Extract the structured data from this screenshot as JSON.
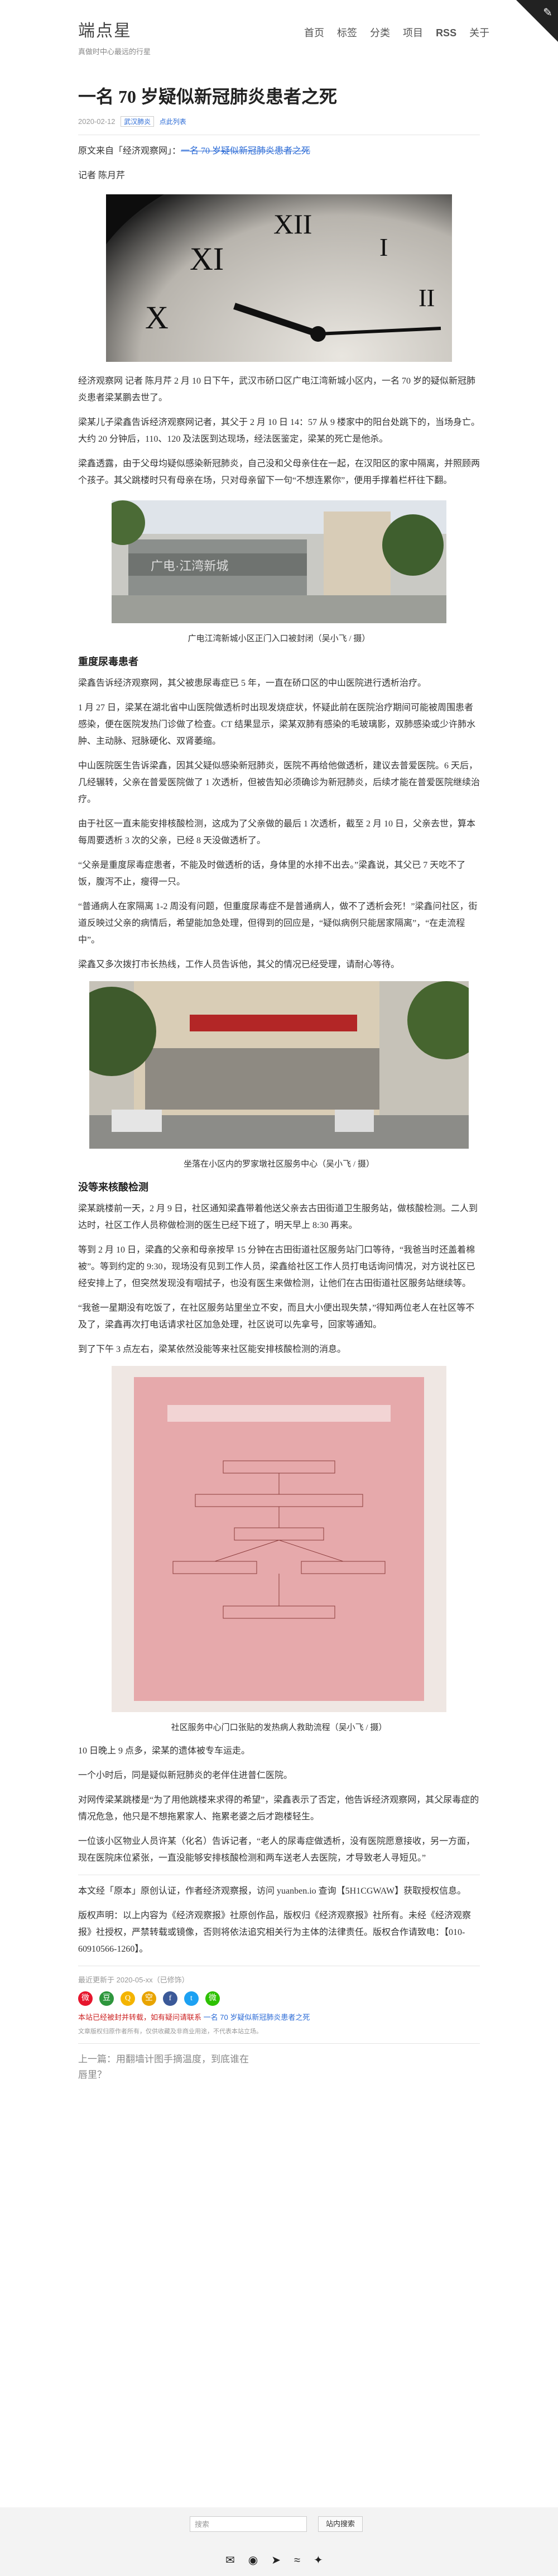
{
  "site": {
    "title": "端点星",
    "subtitle": "真做时中心最远的行星"
  },
  "nav": [
    "首页",
    "标签",
    "分类",
    "项目",
    "RSS",
    "关于"
  ],
  "article": {
    "title": "一名 70 岁疑似新冠肺炎患者之死",
    "date": "2020-02-12",
    "tag1": "武汉肺炎",
    "tag2": "点此列表",
    "source_prefix": "原文来自「经济观察网」：",
    "source_link": "一名 70 岁疑似新冠肺炎患者之死",
    "author": "记者 陈月芹",
    "paragraphs": [
      "经济观察网 记者 陈月芹 2 月 10 日下午，武汉市硚口区广电江湾新城小区内，一名 70 岁的疑似新冠肺炎患者梁某鹏去世了。",
      "梁某儿子梁鑫告诉经济观察网记者，其父于 2 月 10 日 14：57 从 9 楼家中的阳台处跳下的，当场身亡。大约 20 分钟后，110、120 及法医到达现场，经法医鉴定，梁某的死亡是他杀。",
      "梁鑫透露，由于父母均疑似感染新冠肺炎，自己没和父母亲住在一起，在汉阳区的家中隔离，并照顾两个孩子。其父跳楼时只有母亲在场，只对母亲留下一句“不想连累你”，便用手撑着栏杆往下翻。"
    ],
    "cap1": "广电江湾新城小区正门入口被封闭（吴小飞 / 摄）",
    "h_section1": "重度尿毒患者",
    "paragraphs2": [
      "梁鑫告诉经济观察网，其父被患尿毒症已 5 年，一直在硚口区的中山医院进行透析治疗。",
      "1 月 27 日，梁某在湖北省中山医院做透析时出现发烧症状，怀疑此前在医院治疗期间可能被周围患者感染，便在医院发热门诊做了检查。CT 结果显示，梁某双肺有感染的毛玻璃影，双肺感染或少许肺水肿、主动脉、冠脉硬化、双肾萎缩。",
      "中山医院医生告诉梁鑫，因其父疑似感染新冠肺炎，医院不再给他做透析，建议去普爱医院。6 天后，几经辗转，父亲在普爱医院做了 1 次透析，但被告知必须确诊为新冠肺炎，后续才能在普爱医院继续治疗。",
      "由于社区一直未能安排核酸检测，这成为了父亲做的最后 1 次透析，截至 2 月 10 日，父亲去世，算本每周要透析 3 次的父亲，已经 8 天没做透析了。",
      "“父亲是重度尿毒症患者，不能及时做透析的话，身体里的水排不出去。”梁鑫说，其父已 7 天吃不了饭，腹泻不止，瘦得一只。",
      "“普通病人在家隔离 1-2 周没有问题，但重度尿毒症不是普通病人，做不了透析会死！”梁鑫问社区，街道反映过父亲的病情后，希望能加急处理，但得到的回应是，“疑似病例只能居家隔离”，“在走流程中”。",
      "梁鑫又多次拨打市长热线，工作人员告诉他，其父的情况已经受理，请耐心等待。"
    ],
    "cap2": "坐落在小区内的罗家墩社区服务中心（吴小飞 / 摄）",
    "h_section2": "没等来核酸检测",
    "paragraphs3": [
      "梁某跳楼前一天，2 月 9 日，社区通知梁鑫带着他送父亲去古田街道卫生服务站，做核酸检测。二人到达时，社区工作人员称做检测的医生已经下班了，明天早上 8:30 再来。",
      "等到 2 月 10 日，梁鑫的父亲和母亲按早 15 分钟在古田街道社区服务站门口等待，“我爸当时还盖着棉被”。等到约定的 9:30，现场没有见到工作人员，梁鑫给社区工作人员打电话询问情况，对方说社区已经安排上了，但突然发现没有咽拭子，也没有医生来做检测，让他们在古田街道社区服务站继续等。",
      "“我爸一星期没有吃饭了，在社区服务站里坐立不安，而且大小便出现失禁，”得知两位老人在社区等不及了，梁鑫再次打电话请求社区加急处理，社区说可以先拿号，回家等通知。",
      "到了下午 3 点左右，梁某依然没能等来社区能安排核酸检测的消息。"
    ],
    "cap3": "社区服务中心门口张贴的发热病人救助流程（吴小飞 / 摄）",
    "paragraphs4": [
      "10 日晚上 9 点多，梁某的遗体被专车运走。",
      "一个小时后，同是疑似新冠肺炎的老伴住进普仁医院。",
      "对网传梁某跳楼是“为了用他跳楼来求得的希望”，梁鑫表示了否定，他告诉经济观察网，其父尿毒症的情况危急，他只是不想拖累家人、拖累老婆之后才跑楼轻生。",
      "一位该小区物业人员许某（化名）告诉记者，“老人的尿毒症做透析，没有医院愿意接收，另一方面，现在医院床位紧张，一直没能够安排核酸检测和两车送老人去医院，才导致老人寻短见。”"
    ],
    "notice_para": "本文经「原本」原创认证，作者经济观察报，访问 yuanben.io 查询【5H1CGWAW】获取授权信息。",
    "copyright_para": "版权声明：以上内容为《经济观察报》社原创作品，版权归《经济观察报》社所有。未经《经济观察报》社授权，严禁转载或镜像，否则将依法追究相关行为主体的法律责任。版权合作请致电：【010-60910566-1260】。",
    "updated": "最近更新于 2020-05-xx（已修饰）",
    "share_note": "本站已经被封并转载，如有疑问请联系",
    "small_note": "文章版权归原作者所有，仅供收藏及非商业用途，不代表本站立场。",
    "prev_label": "上一篇：用翻墙计图手摘温度，到底谁在唇里？"
  },
  "footer": {
    "search_placeholder": "搜索",
    "search_button": "站内搜索"
  },
  "colors": {
    "link": "#2a6ad6",
    "footer_bg": "#f3f3f3"
  }
}
